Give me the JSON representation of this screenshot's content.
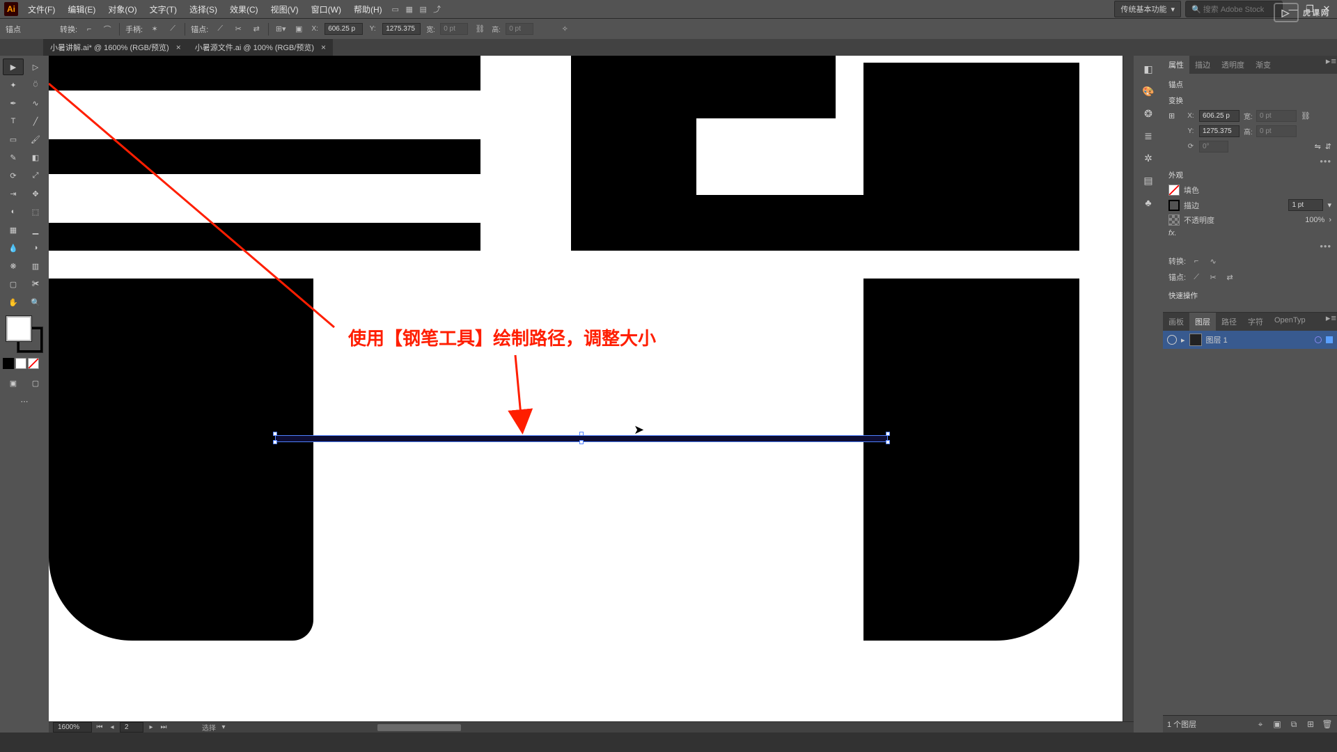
{
  "menu": {
    "items": [
      "文件(F)",
      "编辑(E)",
      "对象(O)",
      "文字(T)",
      "选择(S)",
      "效果(C)",
      "视图(V)",
      "窗口(W)",
      "帮助(H)"
    ]
  },
  "workspace_switcher": "传统基本功能",
  "search_placeholder": "搜索 Adobe Stock",
  "opt": {
    "left_label": "锚点",
    "convert": "转换:",
    "handle": "手柄:",
    "anchor": "锚点:",
    "x_label": "X:",
    "x": "606.25 p",
    "y_label": "Y:",
    "y": "1275.375",
    "w_label": "宽:",
    "w": "0 pt",
    "h_label": "高:",
    "h": "0 pt"
  },
  "tabs": [
    {
      "title": "小暑讲解.ai* @ 1600% (RGB/预览)",
      "active": true
    },
    {
      "title": "小暑源文件.ai @ 100% (RGB/预览)",
      "active": false
    }
  ],
  "zoom": "1600%",
  "page": "2",
  "statusbar_tool": "选择",
  "annotation": "使用【钢笔工具】绘制路径，调整大小",
  "prop": {
    "tabs": [
      "属性",
      "描边",
      "透明度",
      "渐变"
    ],
    "anchor_title": "锚点",
    "transform_title": "变换",
    "x_label": "X:",
    "x": "606.25 p",
    "y_label": "Y:",
    "y": "1275.375",
    "w_label": "宽:",
    "w": "0 pt",
    "h_label": "高:",
    "h": "0 pt",
    "angle_label": "⟳",
    "angle": "0°",
    "appearance_title": "外观",
    "fill_label": "填色",
    "stroke_label": "描边",
    "stroke_value": "1 pt",
    "opacity_label": "不透明度",
    "opacity_value": "100%",
    "fx_label": "fx.",
    "convert_title": "转换:",
    "anchor2_title": "锚点:",
    "quick_title": "快速操作"
  },
  "layers": {
    "tabs": [
      "画板",
      "图层",
      "路径",
      "字符",
      "OpenTyp"
    ],
    "item": "图层 1",
    "count": "1 个图层"
  },
  "watermark": "虎课网"
}
